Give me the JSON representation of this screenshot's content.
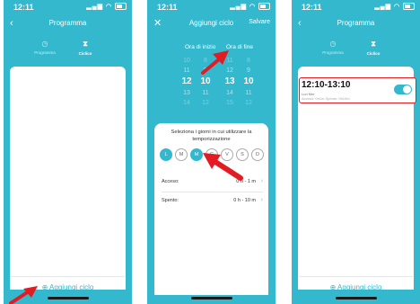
{
  "status": {
    "time": "12:11"
  },
  "colors": {
    "accent": "#33b8ce",
    "highlight": "#e31b23",
    "arrow": "#e31b23"
  },
  "screen1": {
    "title": "Programma",
    "tabs": [
      {
        "label": "Programma",
        "icon": "clock-icon"
      },
      {
        "label": "Ciclico",
        "icon": "hourglass-icon"
      }
    ],
    "add_label": "Aggiungi ciclo"
  },
  "screen2": {
    "title": "Aggiungi ciclo",
    "save_label": "Salvare",
    "start_label": "Ora di inizio",
    "end_label": "Ora di fine",
    "wheel": {
      "start_hours": [
        "10",
        "11",
        "12",
        "13",
        "14"
      ],
      "start_minutes": [
        "8",
        "9",
        "10",
        "11",
        "12"
      ],
      "end_hours": [
        "11",
        "12",
        "13",
        "14",
        "15"
      ],
      "end_minutes": [
        "8",
        "9",
        "10",
        "11",
        "12"
      ]
    },
    "sheet_title": "Seleziona i giorni in cui utilizzare la temporizzazione",
    "days": [
      {
        "label": "L",
        "on": true
      },
      {
        "label": "M",
        "on": false
      },
      {
        "label": "M",
        "on": true
      },
      {
        "label": "G",
        "on": false
      },
      {
        "label": "V",
        "on": false
      },
      {
        "label": "S",
        "on": false
      },
      {
        "label": "D",
        "on": false
      }
    ],
    "on_label": "Acceso:",
    "on_value": "0 h - 1 m",
    "off_label": "Spento:",
    "off_value": "0 h - 10 m"
  },
  "screen3": {
    "title": "Programma",
    "tabs": [
      {
        "label": "Programma",
        "icon": "clock-icon"
      },
      {
        "label": "Ciclico",
        "icon": "hourglass-icon"
      }
    ],
    "schedule": {
      "time": "12:10-13:10",
      "days": "Lun Mer",
      "sub": "Acceso: 0h1m   Spento: 0h10m",
      "enabled": true
    },
    "add_label": "Aggiungi ciclo"
  }
}
